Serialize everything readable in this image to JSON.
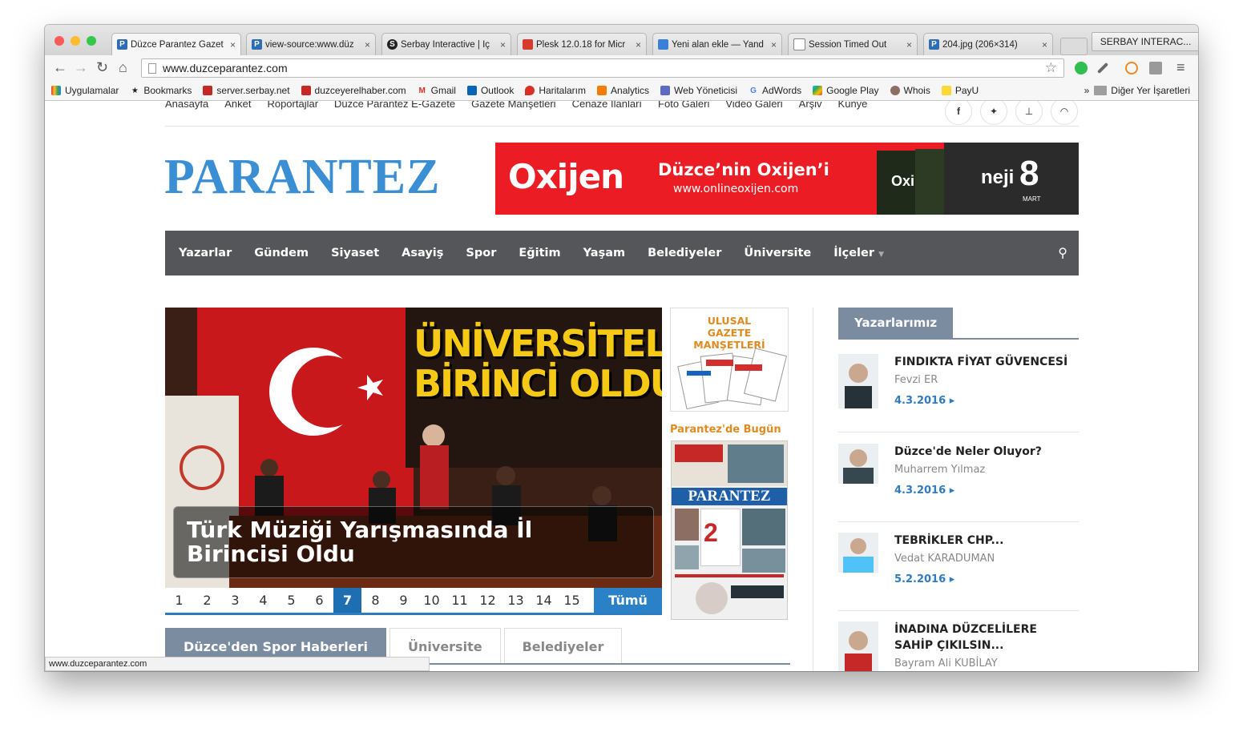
{
  "browser": {
    "tabs": [
      {
        "title": "Düzce Parantez Gazet",
        "favicon": "P"
      },
      {
        "title": "view-source:www.düz",
        "favicon": "P"
      },
      {
        "title": "Serbay Interactive | İç",
        "favicon": "S"
      },
      {
        "title": "Plesk 12.0.18 for Micr",
        "favicon": "plesk"
      },
      {
        "title": "Yeni alan ekle — Yand",
        "favicon": "mail"
      },
      {
        "title": "Session Timed Out",
        "favicon": "page"
      },
      {
        "title": "204.jpg (206×314)",
        "favicon": "P"
      }
    ],
    "tab_close": "×",
    "profile": "SERBAY INTERAC...",
    "url": "www.duzceparantez.com",
    "bookmarks": [
      "Uygulamalar",
      "Bookmarks",
      "server.serbay.net",
      "duzceyerelhaber.com",
      "Gmail",
      "Outlook",
      "Haritalarım",
      "Analytics",
      "Web Yöneticisi",
      "AdWords",
      "Google Play",
      "Whois",
      "PayU"
    ],
    "bookmarks_more": "»",
    "other_bookmarks": "Diğer Yer İşaretleri",
    "status_url": "www.duzceparantez.com"
  },
  "site": {
    "topnav": [
      "Anasayfa",
      "Anket",
      "Röportajlar",
      "Düzce Parantez E-Gazete",
      "Gazete Manşetleri",
      "Cenaze İlanları",
      "Foto Galeri",
      "Video Galeri",
      "Arşiv",
      "Künye"
    ],
    "social_icons": [
      "facebook-icon",
      "twitter-icon",
      "sitemap-icon",
      "rss-icon"
    ],
    "logo": "PARANTEZ",
    "banner": {
      "brand": "Oxijen",
      "headline": "Düzce’nin Oxijen’i",
      "url": "www.onlineoxijen.com",
      "mag_left": "Oxi",
      "mag_right": "neji",
      "mag_digit": "8",
      "mag_month": "MART"
    },
    "mainnav": [
      "Yazarlar",
      "Gündem",
      "Siyaset",
      "Asayiş",
      "Spor",
      "Eğitim",
      "Yaşam",
      "Belediyeler",
      "Üniversite",
      "İlçeler"
    ],
    "slider": {
      "headline_image": "ÜNİVERSİTELİ BİRİNCİ OLDU",
      "image_line1": "ÜNİVERSİTELİ",
      "image_line2": "BİRİNCİ OLDU",
      "caption": "Türk Müziği Yarışmasında İl Birincisi Oldu",
      "pages": [
        "1",
        "2",
        "3",
        "4",
        "5",
        "6",
        "7",
        "8",
        "9",
        "10",
        "11",
        "12",
        "13",
        "14",
        "15"
      ],
      "active_page": "7",
      "all_label": "Tümü"
    },
    "ulusal": {
      "line1": "ULUSAL",
      "line2": "GAZETE MANŞETLERİ"
    },
    "bugun_title": "Parantez'de Bugün",
    "bottom_tabs": [
      "Düzce'den Spor Haberleri",
      "Üniversite",
      "Belediyeler"
    ],
    "authors_title": "Yazarlarımız",
    "authors": [
      {
        "title": "FINDIKTA FİYAT GÜVENCESİ",
        "name": "Fevzi ER",
        "date": "4.3.2016"
      },
      {
        "title": "Düzce'de Neler Oluyor?",
        "name": "Muharrem Yılmaz",
        "date": "4.3.2016"
      },
      {
        "title": "TEBRİKLER CHP...",
        "name": "Vedat KARADUMAN",
        "date": "5.2.2016"
      },
      {
        "title": "İNADINA DÜZCELİLERE SAHİP ÇIKILSIN...",
        "name": "Bayram Ali KUBİLAY",
        "date": ""
      }
    ]
  },
  "colors": {
    "brand_blue": "#3a8fd4",
    "nav_gray": "#54565a",
    "accent_orange": "#e08a22",
    "banner_red": "#ec1c24"
  }
}
